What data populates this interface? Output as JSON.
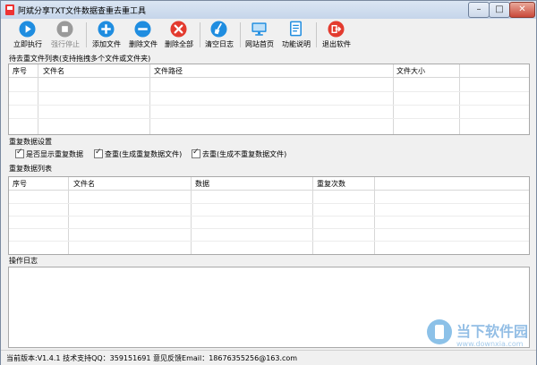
{
  "window": {
    "title": "阿斌分享TXT文件数据查重去重工具"
  },
  "toolbar": {
    "items": [
      {
        "label": "立即执行"
      },
      {
        "label": "强行停止"
      },
      {
        "label": "添加文件"
      },
      {
        "label": "删除文件"
      },
      {
        "label": "删除全部"
      },
      {
        "label": "清空日志"
      },
      {
        "label": "网站首页"
      },
      {
        "label": "功能说明"
      },
      {
        "label": "退出软件"
      }
    ]
  },
  "files_section": {
    "label": "待去重文件列表(支持拖拽多个文件或文件夹)",
    "columns": [
      "序号",
      "文件名",
      "文件路径",
      "文件大小"
    ]
  },
  "settings": {
    "label": "重复数据设置",
    "options": [
      {
        "label": "是否显示重复数据",
        "checked": true
      },
      {
        "label": "查重(生成重复数据文件)",
        "checked": true
      },
      {
        "label": "去重(生成不重复数据文件)",
        "checked": true
      }
    ]
  },
  "dup_section": {
    "label": "重复数据列表",
    "columns": [
      "序号",
      "文件名",
      "数据",
      "重复次数"
    ]
  },
  "log": {
    "label": "操作日志"
  },
  "status": {
    "text": "当前版本:V1.4.1   技术支持QQ：359151691   意见反馈Email：18676355256@163.com"
  },
  "watermark": {
    "text": "当下软件园",
    "url": "www.downxia.com"
  },
  "colors": {
    "play": "#1f8de0",
    "blue": "#1f8de0",
    "red": "#e33b2f",
    "disabled": "#9a9a9a"
  }
}
